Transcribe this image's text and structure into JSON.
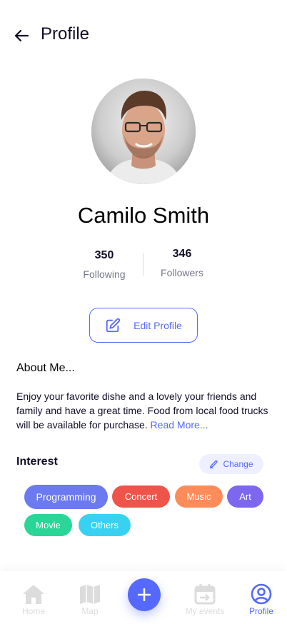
{
  "header": {
    "title": "Profile"
  },
  "profile": {
    "name": "Camilo Smith",
    "following_count": "350",
    "following_label": "Following",
    "followers_count": "346",
    "followers_label": "Followers",
    "edit_label": "Edit Profile"
  },
  "about": {
    "title": "About Me...",
    "text": "Enjoy your favorite dishe and a lovely your friends and family and have a great time. Food from local food trucks will be available for purchase. ",
    "read_more": "Read More..."
  },
  "interest": {
    "title": "Interest",
    "change_label": "Change",
    "chips": [
      {
        "label": "Programming",
        "color": "#6b7af0"
      },
      {
        "label": "Concert",
        "color": "#ee544a"
      },
      {
        "label": "Music",
        "color": "#fe8c5b"
      },
      {
        "label": "Art",
        "color": "#7d67ee"
      },
      {
        "label": "Movie",
        "color": "#29d697"
      },
      {
        "label": "Others",
        "color": "#39d1f2"
      }
    ]
  },
  "nav": {
    "items": [
      {
        "label": "Home",
        "icon": "home-icon"
      },
      {
        "label": "Map",
        "icon": "map-icon"
      },
      {
        "label": "My events",
        "icon": "calendar-icon"
      },
      {
        "label": "Profile",
        "icon": "profile-icon"
      }
    ],
    "fab_icon": "plus-icon"
  },
  "colors": {
    "accent": "#5669ff",
    "inactive": "#dcdcdc"
  }
}
